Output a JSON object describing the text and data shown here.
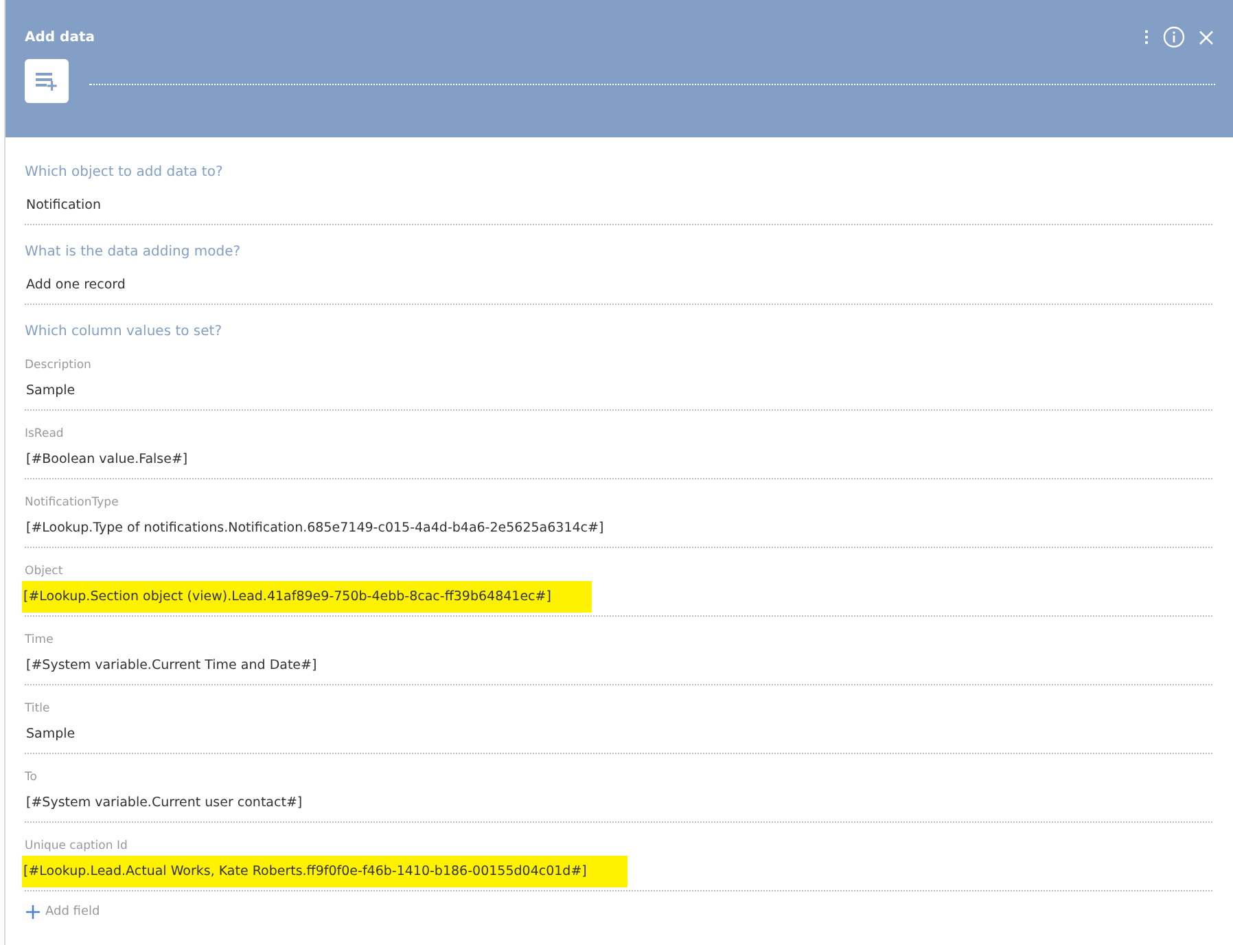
{
  "window": {
    "title": "Add data"
  },
  "questions": [
    {
      "question": "Which object to add data to?",
      "answer": "Notification"
    },
    {
      "question": "What is the data adding mode?",
      "answer": "Add one record"
    }
  ],
  "columns_heading": "Which column values to set?",
  "fields": [
    {
      "label": "Description",
      "value": "Sample",
      "highlighted": false
    },
    {
      "label": "IsRead",
      "value": "[#Boolean value.False#]",
      "highlighted": false
    },
    {
      "label": "NotificationType",
      "value": "[#Lookup.Type of notifications.Notification.685e7149-c015-4a4d-b4a6-2e5625a6314c#]",
      "highlighted": false
    },
    {
      "label": "Object",
      "value": "[#Lookup.Section object (view).Lead.41af89e9-750b-4ebb-8cac-ff39b64841ec#]",
      "highlighted": true
    },
    {
      "label": "Time",
      "value": "[#System variable.Current Time and Date#]",
      "highlighted": false
    },
    {
      "label": "Title",
      "value": "Sample",
      "highlighted": false
    },
    {
      "label": "To",
      "value": "[#System variable.Current user contact#]",
      "highlighted": false
    },
    {
      "label": "Unique caption Id",
      "value": "[#Lookup.Lead.Actual Works, Kate Roberts.ff9f0f0e-f46b-1410-b186-00155d04c01d#]",
      "highlighted": true
    }
  ],
  "add_field": "Add field"
}
